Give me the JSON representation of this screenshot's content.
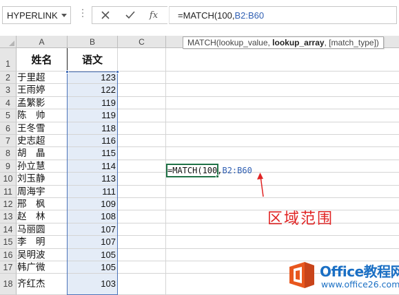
{
  "formula_bar": {
    "name_box": "HYPERLINK",
    "cancel_glyph": "×",
    "enter_glyph": "✓",
    "fx_label": "fx",
    "formula_prefix": "=MATCH(100,",
    "formula_ref": "B2:B60"
  },
  "tooltip": {
    "func": "MATCH(",
    "arg1": "lookup_value, ",
    "arg2": "lookup_array",
    "arg3": ", [match_type])"
  },
  "columns": [
    "A",
    "B",
    "C"
  ],
  "rows": [
    "1",
    "2",
    "3",
    "4",
    "5",
    "6",
    "7",
    "8",
    "9",
    "10",
    "11",
    "12",
    "13",
    "14",
    "15",
    "16",
    "17",
    "18"
  ],
  "table": {
    "header_name": "姓名",
    "header_score": "语文",
    "records": [
      {
        "name": "于里超",
        "score": "123"
      },
      {
        "name": "王雨婷",
        "score": "122"
      },
      {
        "name": "孟繁影",
        "score": "119"
      },
      {
        "name": "陈　帅",
        "score": "119"
      },
      {
        "name": "王冬雪",
        "score": "118"
      },
      {
        "name": "史志超",
        "score": "116"
      },
      {
        "name": "胡　晶",
        "score": "115"
      },
      {
        "name": "孙立慧",
        "score": "114"
      },
      {
        "name": "刘玉静",
        "score": "113"
      },
      {
        "name": "周海宇",
        "score": "111"
      },
      {
        "name": "邢　枫",
        "score": "109"
      },
      {
        "name": "赵　林",
        "score": "108"
      },
      {
        "name": "马丽圆",
        "score": "107"
      },
      {
        "name": "李　明",
        "score": "107"
      },
      {
        "name": "吴明波",
        "score": "105"
      },
      {
        "name": "韩广微",
        "score": "105"
      },
      {
        "name": "齐红杰",
        "score": "103"
      }
    ]
  },
  "active_cell": {
    "prefix": "=MATCH(100,",
    "ref": "B2:B60"
  },
  "annotation": "区域范围",
  "watermark": {
    "brand": "Office教程网",
    "url": "www.office26.com"
  },
  "colors": {
    "range_blue": "#4a72b8",
    "active_green": "#1e7145",
    "annotation_red": "#e02424",
    "brand_blue": "#1a6fc4",
    "logo_orange": "#e8571e"
  }
}
